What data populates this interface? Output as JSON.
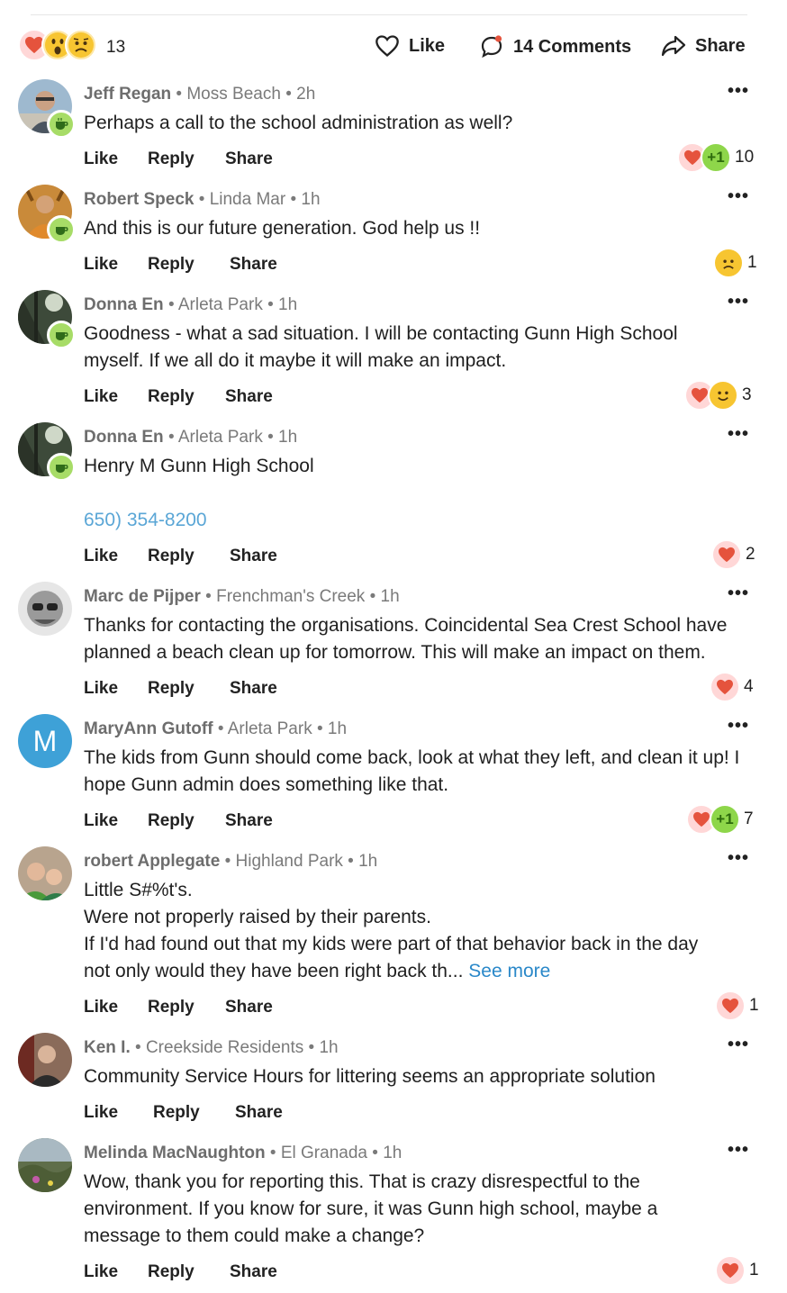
{
  "post_summary": {
    "reaction_count": "13",
    "like_label": "Like",
    "comments_label": "14 Comments",
    "share_label": "Share"
  },
  "actions": {
    "like": "Like",
    "reply": "Reply",
    "share": "Share"
  },
  "comments": [
    {
      "name": "Jeff Regan",
      "neighborhood": "Moss Beach",
      "time": "2h",
      "text": "Perhaps a call to the school administration as well?",
      "reaction_count": "10",
      "reactions": [
        "heart",
        "plus-one"
      ]
    },
    {
      "name": "Robert Speck",
      "neighborhood": "Linda Mar",
      "time": "1h",
      "text": "And this is our future generation. God help us !!",
      "reaction_count": "1",
      "reactions": [
        "sad"
      ]
    },
    {
      "name": "Donna En",
      "neighborhood": "Arleta Park",
      "time": "1h",
      "text": "Goodness - what a sad situation. I will be contacting Gunn High School myself. If we all do it maybe it will make an impact.",
      "reaction_count": "3",
      "reactions": [
        "heart",
        "smile"
      ]
    },
    {
      "name": "Donna En",
      "neighborhood": "Arleta Park",
      "time": "1h",
      "text": "Henry M Gunn High School",
      "phone": "650) 354-8200",
      "reaction_count": "2",
      "reactions": [
        "heart"
      ]
    },
    {
      "name": "Marc de Pijper",
      "neighborhood": "Frenchman's Creek",
      "time": "1h",
      "text": "Thanks for contacting the organisations. Coincidental Sea Crest School have planned a beach clean up for tomorrow. This will make an impact on them.",
      "reaction_count": "4",
      "reactions": [
        "heart"
      ]
    },
    {
      "name": "MaryAnn Gutoff",
      "neighborhood": "Arleta Park",
      "time": "1h",
      "avatar_letter": "M",
      "text": "The kids from Gunn should come back, look at what they left, and clean it up!  I hope Gunn admin does something like that.",
      "reaction_count": "7",
      "reactions": [
        "heart",
        "plus-one"
      ]
    },
    {
      "name": "robert Applegate",
      "neighborhood": "Highland Park",
      "time": "1h",
      "text_lines": [
        "Little S#%t's.",
        "Were not properly raised by their parents.",
        "If I'd had found out that my kids were part of that behavior back in the day",
        "not only would they have been right back th..."
      ],
      "see_more": "See more",
      "reaction_count": "1",
      "reactions": [
        "heart"
      ]
    },
    {
      "name": "Ken I.",
      "neighborhood": "Creekside Residents",
      "time": "1h",
      "text": "Community Service Hours for littering seems an appropriate solution",
      "reaction_count": "",
      "reactions": []
    },
    {
      "name": "Melinda MacNaughton",
      "neighborhood": "El Granada",
      "time": "1h",
      "text": "Wow, thank you for reporting this. That is crazy disrespectful to the environment. If you know for sure, it was Gunn high school, maybe a message to them could make a change?",
      "reaction_count": "1",
      "reactions": [
        "heart"
      ]
    }
  ],
  "colors": {
    "accent_link": "#2a88c9",
    "phone_link": "#5aa6d6",
    "badge_green": "#a7dc67",
    "heart_red": "#e5533d"
  },
  "icons": {
    "like": "heart-outline-icon",
    "comments": "speech-bubble-icon",
    "share": "share-arrow-icon",
    "more": "more-dots-icon",
    "badge": "coffee-cup-icon"
  }
}
